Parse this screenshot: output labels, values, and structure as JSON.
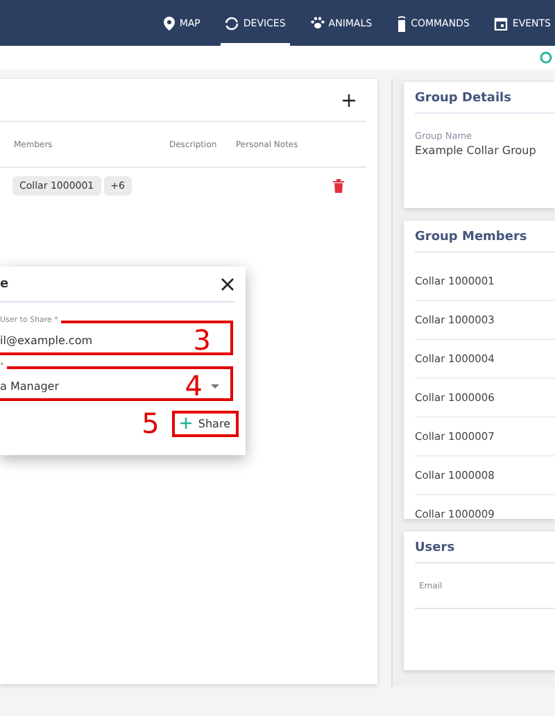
{
  "nav": {
    "items": [
      {
        "label": "MAP",
        "selected": false
      },
      {
        "label": "DEVICES",
        "selected": true
      },
      {
        "label": "ANIMALS",
        "selected": false
      },
      {
        "label": "COMMANDS",
        "selected": false
      },
      {
        "label": "EVENTS",
        "selected": false
      }
    ]
  },
  "groups_table": {
    "columns": [
      "Members",
      "Description",
      "Personal Notes"
    ],
    "rows": [
      {
        "members": [
          "Collar 1000001",
          "+6"
        ]
      }
    ]
  },
  "dialog": {
    "title": "e",
    "user_field": {
      "label": "User to Share *",
      "value": "il@example.com"
    },
    "role_field": {
      "label": "*",
      "value": "a Manager"
    },
    "share_button": "Share"
  },
  "annotations": [
    {
      "number": "3"
    },
    {
      "number": "4"
    },
    {
      "number": "5"
    }
  ],
  "group_details": {
    "title": "Group Details",
    "field_label": "Group Name",
    "field_value": "Example Collar Group"
  },
  "group_members": {
    "title": "Group Members",
    "members": [
      "Collar 1000001",
      "Collar 1000003",
      "Collar 1000004",
      "Collar 1000006",
      "Collar 1000007",
      "Collar 1000008",
      "Collar 1000009"
    ]
  },
  "users": {
    "title": "Users",
    "columns": [
      "Email"
    ]
  }
}
